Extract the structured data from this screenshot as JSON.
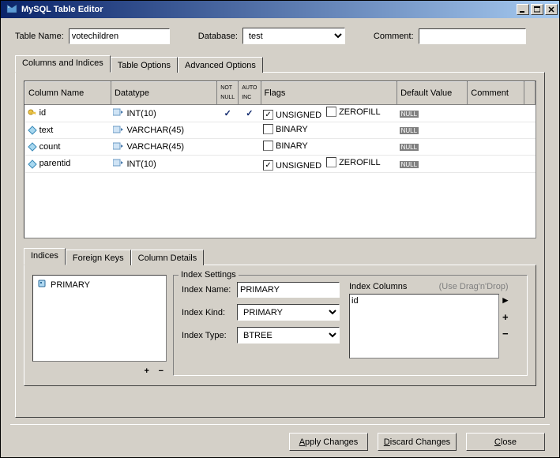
{
  "titlebar": {
    "title": "MySQL Table Editor"
  },
  "header": {
    "tableNameLabel": "Table Name:",
    "tableName": "votechildren",
    "databaseLabel": "Database:",
    "database": "test",
    "commentLabel": "Comment:",
    "comment": ""
  },
  "mainTabs": {
    "columnsIndices": "Columns and Indices",
    "tableOptions": "Table Options",
    "advanced": "Advanced Options"
  },
  "gridHeaders": {
    "colName": "Column Name",
    "datatype": "Datatype",
    "notNull": "NOT NULL",
    "autoInc": "AUTO INC",
    "flags": "Flags",
    "defaultVal": "Default Value",
    "comment": "Comment"
  },
  "flagsLabels": {
    "unsigned": "UNSIGNED",
    "zerofill": "ZEROFILL",
    "binary": "BINARY"
  },
  "columns": [
    {
      "name": "id",
      "datatype": "INT(10)",
      "notNull": true,
      "autoInc": true,
      "flags": "uz",
      "unsignedChecked": true,
      "zerofillChecked": false,
      "default": "NULL",
      "primary": true
    },
    {
      "name": "text",
      "datatype": "VARCHAR(45)",
      "notNull": false,
      "autoInc": false,
      "flags": "b",
      "binaryChecked": false,
      "default": "NULL"
    },
    {
      "name": "count",
      "datatype": "VARCHAR(45)",
      "notNull": false,
      "autoInc": false,
      "flags": "b",
      "binaryChecked": false,
      "default": "NULL"
    },
    {
      "name": "parentid",
      "datatype": "INT(10)",
      "notNull": false,
      "autoInc": false,
      "flags": "uz",
      "unsignedChecked": true,
      "zerofillChecked": false,
      "default": "NULL"
    }
  ],
  "subTabs": {
    "indices": "Indices",
    "foreignKeys": "Foreign Keys",
    "columnDetails": "Column Details"
  },
  "indices": {
    "list": [
      "PRIMARY"
    ],
    "settingsLegend": "Index Settings",
    "nameLabel": "Index Name:",
    "name": "PRIMARY",
    "kindLabel": "Index Kind:",
    "kind": "PRIMARY",
    "typeLabel": "Index Type:",
    "type": "BTREE",
    "columnsLabel": "Index Columns",
    "hint": "(Use Drag'n'Drop)",
    "indexColumns": [
      "id"
    ]
  },
  "buttons": {
    "apply": "Apply Changes",
    "applyUL": "A",
    "discard": "Discard Changes",
    "discardUL": "D",
    "close": "Close",
    "closeUL": "C"
  }
}
